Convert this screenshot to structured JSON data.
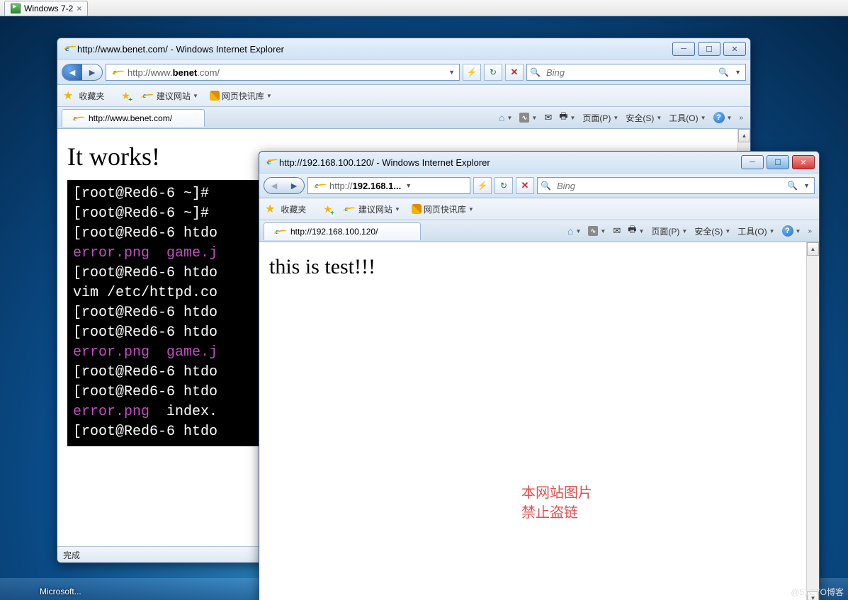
{
  "vm_tab": {
    "label": "Windows 7-2"
  },
  "win1": {
    "title": "http://www.benet.com/ - Windows Internet Explorer",
    "url": "http://www.benet.com/",
    "url_display_prefix": "http://www.",
    "url_display_bold": "benet",
    "url_display_suffix": ".com/",
    "search_placeholder": "Bing",
    "favorites_label": "收藏夹",
    "suggest_label": "建议网站",
    "snap_label": "网页快讯库",
    "tab_label": "http://www.benet.com/",
    "cmd_page": "页面(P)",
    "cmd_safe": "安全(S)",
    "cmd_tool": "工具(O)",
    "heading": "It works!",
    "terminal": [
      {
        "t": "[root@Red6-6 ~]#",
        "c": "w"
      },
      {
        "t": "[root@Red6-6 ~]#",
        "c": "w"
      },
      {
        "t": "[root@Red6-6 htdo",
        "c": "w"
      },
      {
        "t": "error.png  game.j",
        "c": "m"
      },
      {
        "t": "[root@Red6-6 htdo",
        "c": "w"
      },
      {
        "t": "vim /etc/httpd.co",
        "c": "w"
      },
      {
        "t": "[root@Red6-6 htdo",
        "c": "w"
      },
      {
        "t": "[root@Red6-6 htdo",
        "c": "w"
      },
      {
        "t": "error.png  game.j",
        "c": "m"
      },
      {
        "t": "[root@Red6-6 htdo",
        "c": "w"
      },
      {
        "t": "[root@Red6-6 htdo",
        "c": "w"
      },
      {
        "t": "error.png  index.",
        "c": "m2"
      },
      {
        "t": "[root@Red6-6 htdo",
        "c": "w"
      }
    ],
    "status": "完成"
  },
  "win2": {
    "title": "http://192.168.100.120/ - Windows Internet Explorer",
    "url_display": "http://192.168.1...",
    "search_placeholder": "Bing",
    "favorites_label": "收藏夹",
    "suggest_label": "建议网站",
    "snap_label": "网页快讯库",
    "tab_label": "http://192.168.100.120/",
    "cmd_page": "页面(P)",
    "cmd_safe": "安全(S)",
    "cmd_tool": "工具(O)",
    "heading": "this is test!!!",
    "wm_line1": "本网站图片",
    "wm_line2": "禁止盗链"
  },
  "taskbar_app": "Microsoft...",
  "watermark": "@51CTO博客"
}
